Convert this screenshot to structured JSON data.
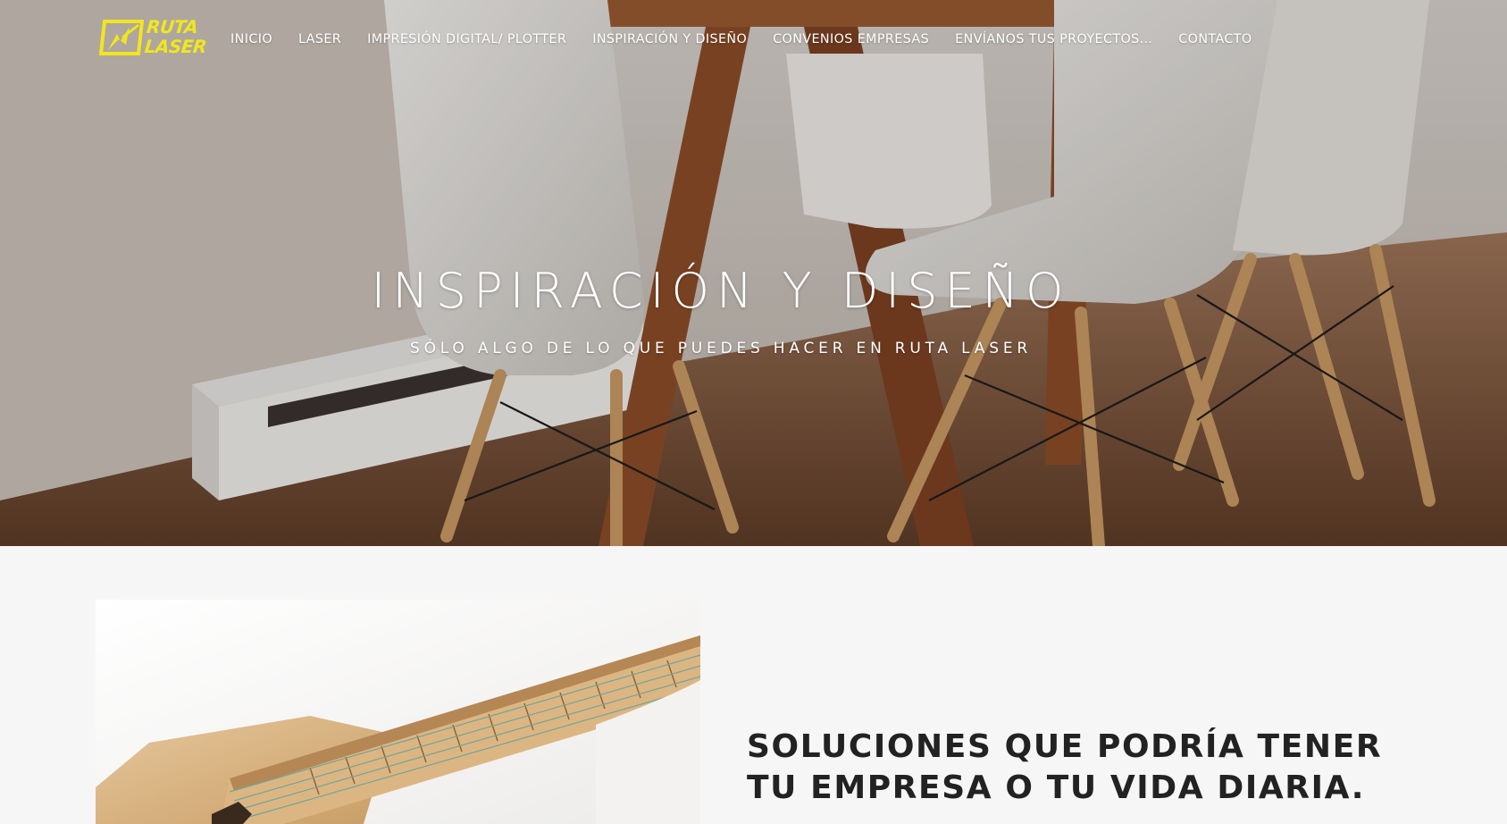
{
  "brand": {
    "logo_text_line1": "RUTA",
    "logo_text_line2": "LASER",
    "logo_color": "#f1e61e"
  },
  "nav": {
    "items": [
      {
        "label": "INICIO"
      },
      {
        "label": "LASER"
      },
      {
        "label": "IMPRESIÓN DIGITAL/ PLOTTER"
      },
      {
        "label": "INSPIRACIÓN Y DISEÑO"
      },
      {
        "label": "CONVENIOS EMPRESAS"
      },
      {
        "label": "ENVÍANOS TUS PROYECTOS…"
      },
      {
        "label": "CONTACTO"
      }
    ]
  },
  "hero": {
    "title": "INSPIRACIÓN Y DISEÑO",
    "subtitle": "SÓLO ALGO DE LO QUE PUEDES HACER EN RUTA LASER",
    "image_icon": "dining-chairs-photo"
  },
  "section": {
    "heading_line1": "SOLUCIONES QUE PODRÍA TENER",
    "heading_line2": "TU EMPRESA O TU VIDA DIARIA.",
    "image_icon": "laser-cut-guitar-photo"
  }
}
